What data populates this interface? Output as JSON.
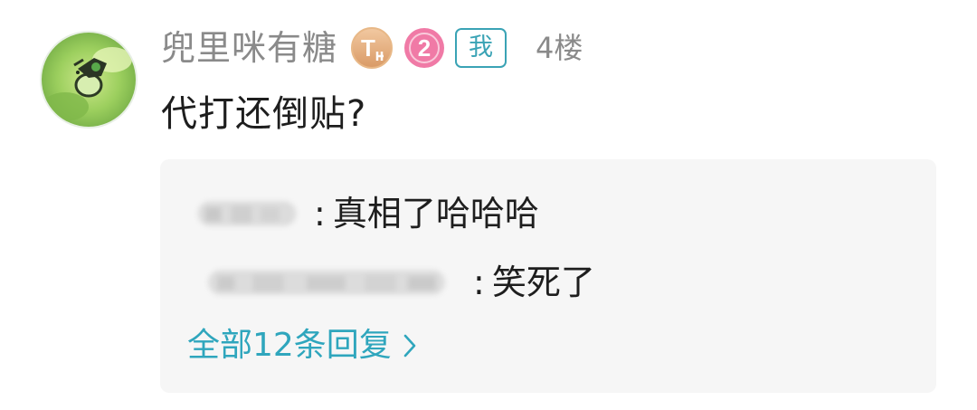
{
  "post": {
    "username": "兜里咪有糖",
    "floor": "4楼",
    "me_tag": "我",
    "comment": "代打还倒贴?",
    "badges": {
      "title_badge": "T",
      "level": "2"
    }
  },
  "replies": {
    "items": [
      {
        "separator": ":",
        "text": "真相了哈哈哈"
      },
      {
        "separator": ":",
        "text": "笑死了"
      }
    ],
    "view_all": "全部12条回复"
  },
  "colors": {
    "accent": "#2fa6bd",
    "username": "#8a8a8a",
    "level_badge": "#f06e9e",
    "title_badge": "#e0a878",
    "reply_background": "#f6f6f6"
  },
  "icons": {
    "title_badge": "title-badge-icon",
    "level_badge": "level-badge-icon",
    "chevron": "chevron-right-icon"
  }
}
